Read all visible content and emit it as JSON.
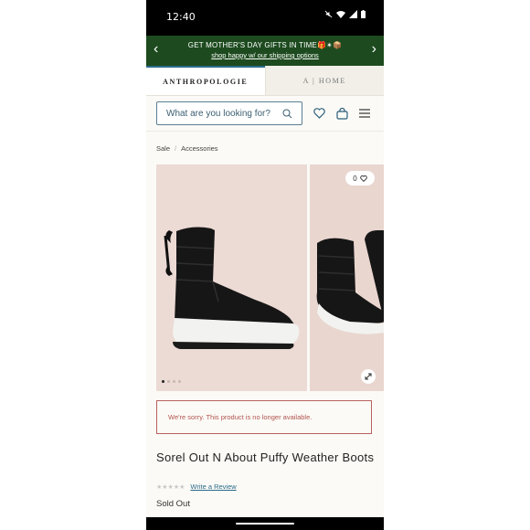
{
  "status_bar": {
    "time": "12:40"
  },
  "promo": {
    "headline": "GET MOTHER'S DAY GIFTS IN TIME🎁✴📦",
    "link": "shop happy w/ our shipping options"
  },
  "tabs": [
    {
      "label": "ANTHROPOLOGIE"
    },
    {
      "label": "A | HOME"
    }
  ],
  "search": {
    "placeholder": "What are you looking for?"
  },
  "breadcrumb": [
    {
      "label": "Sale"
    },
    {
      "label": "Accessories"
    }
  ],
  "gallery": {
    "wishlist_count": "0",
    "image_count": 4,
    "active_image": 1
  },
  "notice": "We're sorry. This product is no longer available.",
  "product": {
    "title": "Sorel Out N About Puffy Weather Boots",
    "review_link": "Write a Review",
    "stars": "★★★★★",
    "availability": "Sold Out"
  },
  "colors": {
    "promo_bg": "#1d4b1f",
    "accent": "#2b6b8a",
    "error": "#b8615f"
  }
}
